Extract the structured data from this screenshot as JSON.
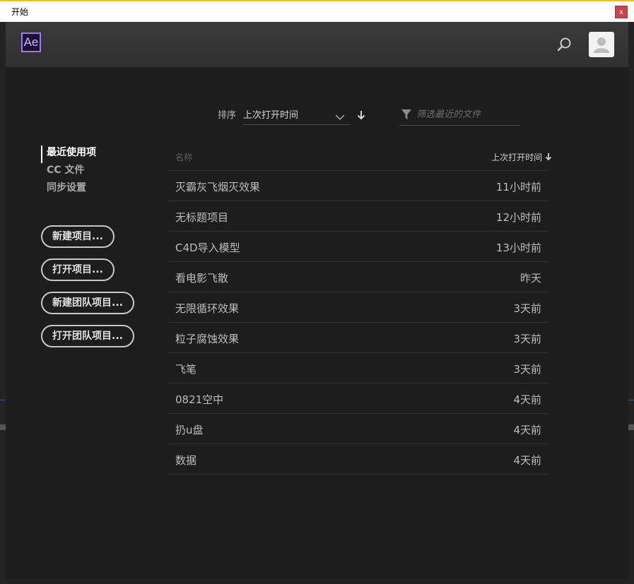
{
  "window": {
    "title": "开始",
    "close_label": "x"
  },
  "header": {
    "logo_text": "Ae"
  },
  "sort": {
    "label": "排序",
    "selected": "上次打开时间"
  },
  "filter": {
    "placeholder": "筛选最近的文件"
  },
  "nav": {
    "items": [
      {
        "label": "最近使用项",
        "active": true
      },
      {
        "label": "CC 文件",
        "active": false
      },
      {
        "label": "同步设置",
        "active": false
      }
    ]
  },
  "actions": {
    "new_project": "新建项目...",
    "open_project": "打开项目...",
    "new_team_project": "新建团队项目...",
    "open_team_project": "打开团队项目..."
  },
  "table": {
    "col_name": "名称",
    "col_time": "上次打开时间",
    "rows": [
      {
        "name": "灭霸灰飞烟灭效果",
        "time": "11小时前"
      },
      {
        "name": "无标题项目",
        "time": "12小时前"
      },
      {
        "name": "C4D导入模型",
        "time": "13小时前"
      },
      {
        "name": "看电影飞散",
        "time": "昨天"
      },
      {
        "name": "无限循环效果",
        "time": "3天前"
      },
      {
        "name": "粒子腐蚀效果",
        "time": "3天前"
      },
      {
        "name": "飞笔",
        "time": "3天前"
      },
      {
        "name": "0821空中",
        "time": "4天前"
      },
      {
        "name": "扔u盘",
        "time": "4天前"
      },
      {
        "name": "数据",
        "time": "4天前"
      }
    ]
  },
  "icons": {
    "search": "search-icon",
    "avatar": "user-icon",
    "chevron": "chevron-down-icon",
    "sort_direction": "arrow-down-icon",
    "filter": "filter-icon"
  },
  "colors": {
    "ae_logo_border": "#9c7cf4",
    "ae_logo_bg": "#1f0e33",
    "close_button": "#c8464b"
  }
}
